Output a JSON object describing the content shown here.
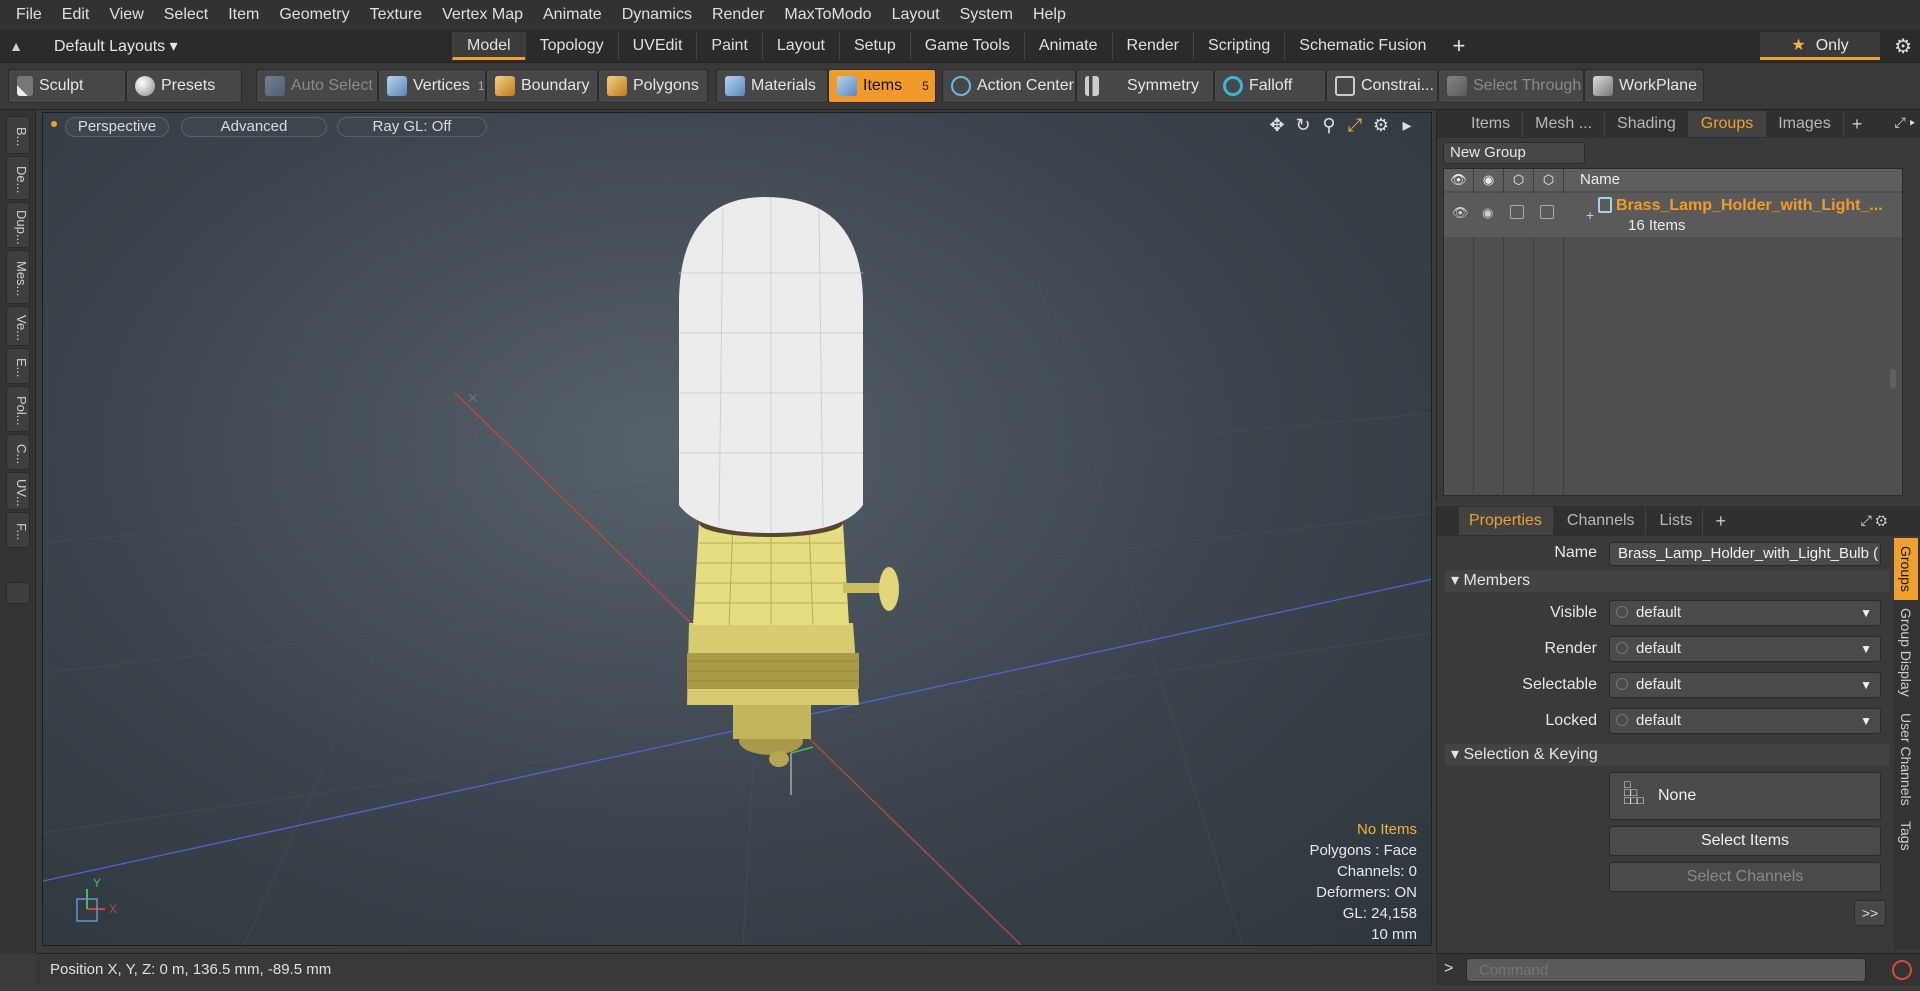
{
  "menu": [
    "File",
    "Edit",
    "View",
    "Select",
    "Item",
    "Geometry",
    "Texture",
    "Vertex Map",
    "Animate",
    "Dynamics",
    "Render",
    "MaxToModo",
    "Layout",
    "System",
    "Help"
  ],
  "layout": {
    "current": "Default Layouts",
    "tabs": [
      "Model",
      "Topology",
      "UVEdit",
      "Paint",
      "Layout",
      "Setup",
      "Game Tools",
      "Animate",
      "Render",
      "Scripting",
      "Schematic Fusion"
    ],
    "active_tab": "Model",
    "only_label": "Only"
  },
  "toolbar": {
    "sculpt": "Sculpt",
    "presets": "Presets",
    "auto_select": "Auto Select",
    "vertices": "Vertices",
    "vertices_count": "1",
    "boundary": "Boundary",
    "polygons": "Polygons",
    "materials": "Materials",
    "items": "Items",
    "items_count": "5",
    "action_center": "Action Center",
    "symmetry": "Symmetry",
    "falloff": "Falloff",
    "constraints": "Constrai...",
    "select_through": "Select Through",
    "workplane": "WorkPlane"
  },
  "left_strip": [
    "B...",
    "De...",
    "Dup...",
    "Mes...",
    "Ve...",
    "E...",
    "Pol...",
    "C...",
    "UV...",
    "F..."
  ],
  "viewport": {
    "view": "Perspective",
    "shading": "Advanced",
    "raygl": "Ray GL: Off",
    "info": {
      "selection": "No Items",
      "polygons": "Polygons : Face",
      "channels": "Channels: 0",
      "deformers": "Deformers: ON",
      "gl": "GL: 24,158",
      "scale": "10 mm"
    },
    "axis_y": "Y",
    "axis_x": "X"
  },
  "status": {
    "position": "Position X, Y, Z:   0 m, 136.5 mm, -89.5 mm"
  },
  "groups_panel": {
    "tabs": [
      "Items",
      "Mesh ...",
      "Shading",
      "Groups",
      "Images"
    ],
    "active_tab": "Groups",
    "new_group": "New Group",
    "col_name": "Name",
    "group_name": "Brass_Lamp_Holder_with_Light_...",
    "group_count": "16 Items"
  },
  "properties": {
    "tabs": [
      "Properties",
      "Channels",
      "Lists"
    ],
    "active_tab": "Properties",
    "side_tabs": [
      "Groups",
      "Group Display",
      "User Channels",
      "Tags"
    ],
    "name_label": "Name",
    "name_value": "Brass_Lamp_Holder_with_Light_Bulb (",
    "members_section": "Members",
    "visible_label": "Visible",
    "visible_value": "default",
    "render_label": "Render",
    "render_value": "default",
    "selectable_label": "Selectable",
    "selectable_value": "default",
    "locked_label": "Locked",
    "locked_value": "default",
    "sk_section": "Selection & Keying",
    "none_label": "None",
    "select_items": "Select Items",
    "select_channels": "Select Channels",
    "more": ">>"
  },
  "command": {
    "placeholder": "Command"
  },
  "colors": {
    "accent": "#f0a030",
    "group_name": "#f39b28",
    "bulb": "#ececec",
    "brass": "#e6dc80"
  }
}
